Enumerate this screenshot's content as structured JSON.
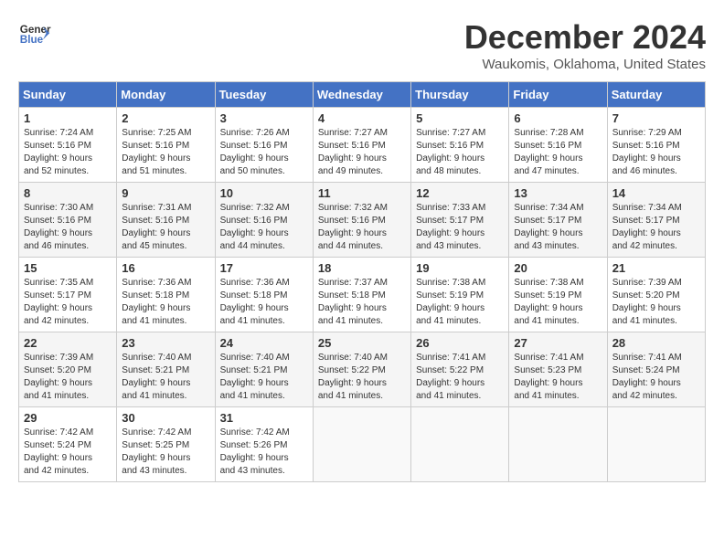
{
  "header": {
    "logo_line1": "General",
    "logo_line2": "Blue",
    "month": "December 2024",
    "location": "Waukomis, Oklahoma, United States"
  },
  "days_of_week": [
    "Sunday",
    "Monday",
    "Tuesday",
    "Wednesday",
    "Thursday",
    "Friday",
    "Saturday"
  ],
  "weeks": [
    [
      {
        "day": "1",
        "text": "Sunrise: 7:24 AM\nSunset: 5:16 PM\nDaylight: 9 hours\nand 52 minutes."
      },
      {
        "day": "2",
        "text": "Sunrise: 7:25 AM\nSunset: 5:16 PM\nDaylight: 9 hours\nand 51 minutes."
      },
      {
        "day": "3",
        "text": "Sunrise: 7:26 AM\nSunset: 5:16 PM\nDaylight: 9 hours\nand 50 minutes."
      },
      {
        "day": "4",
        "text": "Sunrise: 7:27 AM\nSunset: 5:16 PM\nDaylight: 9 hours\nand 49 minutes."
      },
      {
        "day": "5",
        "text": "Sunrise: 7:27 AM\nSunset: 5:16 PM\nDaylight: 9 hours\nand 48 minutes."
      },
      {
        "day": "6",
        "text": "Sunrise: 7:28 AM\nSunset: 5:16 PM\nDaylight: 9 hours\nand 47 minutes."
      },
      {
        "day": "7",
        "text": "Sunrise: 7:29 AM\nSunset: 5:16 PM\nDaylight: 9 hours\nand 46 minutes."
      }
    ],
    [
      {
        "day": "8",
        "text": "Sunrise: 7:30 AM\nSunset: 5:16 PM\nDaylight: 9 hours\nand 46 minutes."
      },
      {
        "day": "9",
        "text": "Sunrise: 7:31 AM\nSunset: 5:16 PM\nDaylight: 9 hours\nand 45 minutes."
      },
      {
        "day": "10",
        "text": "Sunrise: 7:32 AM\nSunset: 5:16 PM\nDaylight: 9 hours\nand 44 minutes."
      },
      {
        "day": "11",
        "text": "Sunrise: 7:32 AM\nSunset: 5:16 PM\nDaylight: 9 hours\nand 44 minutes."
      },
      {
        "day": "12",
        "text": "Sunrise: 7:33 AM\nSunset: 5:17 PM\nDaylight: 9 hours\nand 43 minutes."
      },
      {
        "day": "13",
        "text": "Sunrise: 7:34 AM\nSunset: 5:17 PM\nDaylight: 9 hours\nand 43 minutes."
      },
      {
        "day": "14",
        "text": "Sunrise: 7:34 AM\nSunset: 5:17 PM\nDaylight: 9 hours\nand 42 minutes."
      }
    ],
    [
      {
        "day": "15",
        "text": "Sunrise: 7:35 AM\nSunset: 5:17 PM\nDaylight: 9 hours\nand 42 minutes."
      },
      {
        "day": "16",
        "text": "Sunrise: 7:36 AM\nSunset: 5:18 PM\nDaylight: 9 hours\nand 41 minutes."
      },
      {
        "day": "17",
        "text": "Sunrise: 7:36 AM\nSunset: 5:18 PM\nDaylight: 9 hours\nand 41 minutes."
      },
      {
        "day": "18",
        "text": "Sunrise: 7:37 AM\nSunset: 5:18 PM\nDaylight: 9 hours\nand 41 minutes."
      },
      {
        "day": "19",
        "text": "Sunrise: 7:38 AM\nSunset: 5:19 PM\nDaylight: 9 hours\nand 41 minutes."
      },
      {
        "day": "20",
        "text": "Sunrise: 7:38 AM\nSunset: 5:19 PM\nDaylight: 9 hours\nand 41 minutes."
      },
      {
        "day": "21",
        "text": "Sunrise: 7:39 AM\nSunset: 5:20 PM\nDaylight: 9 hours\nand 41 minutes."
      }
    ],
    [
      {
        "day": "22",
        "text": "Sunrise: 7:39 AM\nSunset: 5:20 PM\nDaylight: 9 hours\nand 41 minutes."
      },
      {
        "day": "23",
        "text": "Sunrise: 7:40 AM\nSunset: 5:21 PM\nDaylight: 9 hours\nand 41 minutes."
      },
      {
        "day": "24",
        "text": "Sunrise: 7:40 AM\nSunset: 5:21 PM\nDaylight: 9 hours\nand 41 minutes."
      },
      {
        "day": "25",
        "text": "Sunrise: 7:40 AM\nSunset: 5:22 PM\nDaylight: 9 hours\nand 41 minutes."
      },
      {
        "day": "26",
        "text": "Sunrise: 7:41 AM\nSunset: 5:22 PM\nDaylight: 9 hours\nand 41 minutes."
      },
      {
        "day": "27",
        "text": "Sunrise: 7:41 AM\nSunset: 5:23 PM\nDaylight: 9 hours\nand 41 minutes."
      },
      {
        "day": "28",
        "text": "Sunrise: 7:41 AM\nSunset: 5:24 PM\nDaylight: 9 hours\nand 42 minutes."
      }
    ],
    [
      {
        "day": "29",
        "text": "Sunrise: 7:42 AM\nSunset: 5:24 PM\nDaylight: 9 hours\nand 42 minutes."
      },
      {
        "day": "30",
        "text": "Sunrise: 7:42 AM\nSunset: 5:25 PM\nDaylight: 9 hours\nand 43 minutes."
      },
      {
        "day": "31",
        "text": "Sunrise: 7:42 AM\nSunset: 5:26 PM\nDaylight: 9 hours\nand 43 minutes."
      },
      {
        "day": "",
        "text": ""
      },
      {
        "day": "",
        "text": ""
      },
      {
        "day": "",
        "text": ""
      },
      {
        "day": "",
        "text": ""
      }
    ]
  ]
}
